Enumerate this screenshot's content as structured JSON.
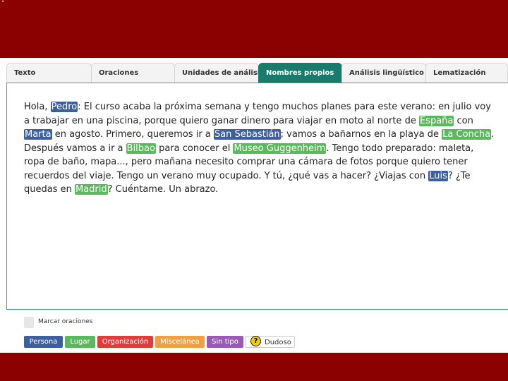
{
  "tabs": [
    {
      "label": "Texto",
      "active": false
    },
    {
      "label": "Oraciones",
      "active": false
    },
    {
      "label": "Unidades de análisis",
      "active": false
    },
    {
      "label": "Nombres propios",
      "active": true
    },
    {
      "label": "Análisis lingüístico",
      "active": false
    },
    {
      "label": "Lematización",
      "active": false
    }
  ],
  "text": [
    {
      "t": "Hola, "
    },
    {
      "t": "Pedro",
      "type": "persona"
    },
    {
      "t": ": El curso acaba la próxima semana y tengo muchos planes para este verano: en julio voy a trabajar en una piscina, porque quiero ganar dinero para viajar en moto al norte de "
    },
    {
      "t": "España",
      "type": "lugar"
    },
    {
      "t": " con "
    },
    {
      "t": "Marta",
      "type": "persona"
    },
    {
      "t": " en agosto. Primero, queremos ir a "
    },
    {
      "t": "San Sebastián",
      "type": "persona"
    },
    {
      "t": "; vamos a bañarnos en la playa de "
    },
    {
      "t": "La Concha",
      "type": "lugar"
    },
    {
      "t": ". Después vamos a ir a "
    },
    {
      "t": "Bilbao",
      "type": "lugar"
    },
    {
      "t": " para conocer el "
    },
    {
      "t": "Museo Guggenheim",
      "type": "lugar"
    },
    {
      "t": ". Tengo todo preparado: maleta, ropa de baño, mapa..., pero mañana necesito comprar una cámara de fotos porque quiero tener recuerdos del viaje. Tengo un verano muy ocupado. Y tú, ¿qué vas a hacer? ¿Viajas con "
    },
    {
      "t": "Luis",
      "type": "persona"
    },
    {
      "t": "? ¿Te quedas en "
    },
    {
      "t": "Madrid",
      "type": "lugar"
    },
    {
      "t": "? Cuéntame. Un abrazo."
    }
  ],
  "mark_sentences": {
    "label": "Marcar oraciones",
    "checked": false
  },
  "legend": [
    {
      "label": "Persona",
      "color": "#3d5f9e"
    },
    {
      "label": "Lugar",
      "color": "#5cb85c"
    },
    {
      "label": "Organización",
      "color": "#e03c3c"
    },
    {
      "label": "Miscelánea",
      "color": "#f0a040"
    },
    {
      "label": "Sin tipo",
      "color": "#9b59b6"
    },
    {
      "label": "Dudoso",
      "icon": "question-icon",
      "icon_glyph": "?"
    }
  ],
  "corner_text": "°"
}
